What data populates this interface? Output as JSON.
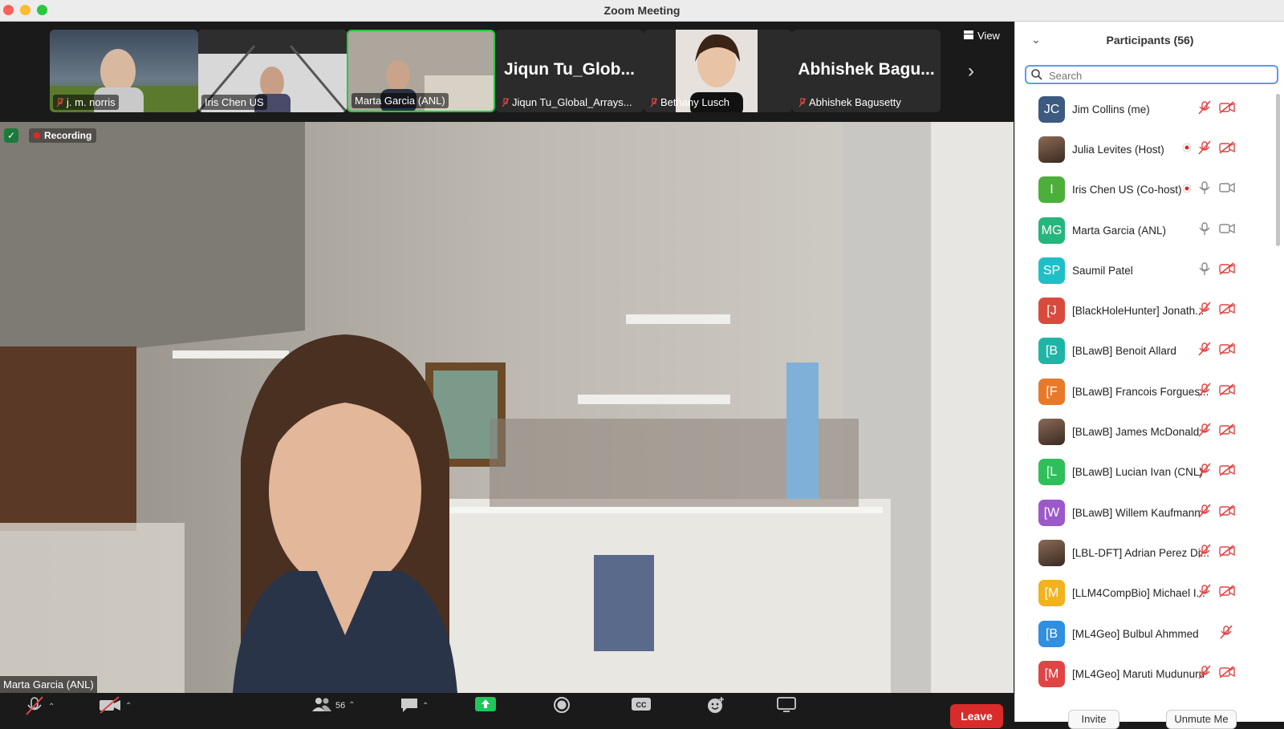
{
  "window": {
    "title": "Zoom Meeting"
  },
  "strip": {
    "view_label": "View",
    "tiles": [
      {
        "name": "j. m. norris",
        "muted": true,
        "kind": "photo-storm"
      },
      {
        "name": "Iris Chen US",
        "muted": false,
        "kind": "photo-hall"
      },
      {
        "name": "Marta Garcia (ANL)",
        "muted": false,
        "kind": "photo-room",
        "active": true
      },
      {
        "name": "Jiqun Tu_Global_Arrays...",
        "big": "Jiqun Tu_Glob...",
        "muted": true,
        "kind": "name-only"
      },
      {
        "name": "Bethany Lusch",
        "muted": true,
        "kind": "photo-face"
      },
      {
        "name": "Abhishek Bagusetty",
        "big": "Abhishek Bagu...",
        "muted": true,
        "kind": "name-only"
      }
    ]
  },
  "video": {
    "recording_label": "Recording",
    "speaker_name": "Marta Garcia (ANL)"
  },
  "toolbar": {
    "participants_count": "56",
    "leave_label": "Leave"
  },
  "panel": {
    "title": "Participants (56)",
    "search_placeholder": "Search",
    "invite_label": "Invite",
    "unmute_label": "Unmute Me",
    "participants": [
      {
        "initials": "JC",
        "name": "Jim Collins (me)",
        "color": "#3d5a80",
        "rec": false,
        "mic": "muted",
        "cam": "off"
      },
      {
        "initials": "",
        "name": "Julia Levites (Host)",
        "color": "#6b4a3a",
        "photo": true,
        "rec": true,
        "mic": "muted",
        "cam": "off"
      },
      {
        "initials": "I",
        "name": "Iris Chen US (Co-host)",
        "color": "#4caf3a",
        "rec": true,
        "mic": "on",
        "cam": "on"
      },
      {
        "initials": "MG",
        "name": "Marta Garcia (ANL)",
        "color": "#25b67d",
        "rec": false,
        "mic": "on",
        "cam": "on"
      },
      {
        "initials": "SP",
        "name": "Saumil Patel",
        "color": "#1fbfc7",
        "rec": false,
        "mic": "on",
        "cam": "off"
      },
      {
        "initials": "[J",
        "name": "[BlackHoleHunter] Jonath...",
        "color": "#d94a3c",
        "rec": false,
        "mic": "muted",
        "cam": "off"
      },
      {
        "initials": "[B",
        "name": "[BLawB] Benoit Allard",
        "color": "#1fb5a6",
        "rec": false,
        "mic": "muted",
        "cam": "off"
      },
      {
        "initials": "[F",
        "name": "[BLawB] Francois Forgues...",
        "color": "#e8792a",
        "rec": false,
        "mic": "muted",
        "cam": "off"
      },
      {
        "initials": "",
        "name": "[BLawB] James McDonald",
        "color": "#7a1f1f",
        "photo": true,
        "rec": false,
        "mic": "muted",
        "cam": "off"
      },
      {
        "initials": "[L",
        "name": "[BLawB] Lucian Ivan (CNL)",
        "color": "#2fbf5a",
        "rec": false,
        "mic": "muted",
        "cam": "off"
      },
      {
        "initials": "[W",
        "name": "[BLawB] Willem Kaufmann",
        "color": "#9b59c9",
        "rec": false,
        "mic": "muted",
        "cam": "off"
      },
      {
        "initials": "",
        "name": "[LBL-DFT] Adrian Perez Di...",
        "color": "#8a8a8a",
        "photo": true,
        "rec": false,
        "mic": "muted",
        "cam": "off"
      },
      {
        "initials": "[M",
        "name": "[LLM4CompBio] Michael I...",
        "color": "#f2b21d",
        "rec": false,
        "mic": "muted",
        "cam": "off"
      },
      {
        "initials": "[B",
        "name": "[ML4Geo] Bulbul Ahmmed",
        "color": "#2f8fe0",
        "rec": false,
        "mic": "muted",
        "cam": "none"
      },
      {
        "initials": "[M",
        "name": "[ML4Geo] Maruti Mudunuru",
        "color": "#e04545",
        "rec": false,
        "mic": "muted",
        "cam": "off"
      }
    ]
  }
}
